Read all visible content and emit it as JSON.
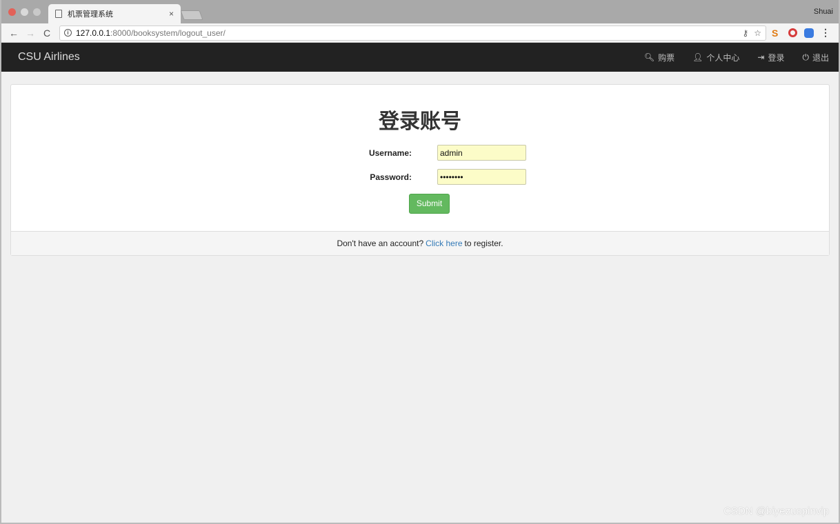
{
  "browser": {
    "tab_title": "机票管理系统",
    "tab_close": "×",
    "profile_name": "Shuai",
    "url_host": "127.0.0.1",
    "url_rest": ":8000/booksystem/logout_user/"
  },
  "navbar": {
    "brand": "CSU Airlines",
    "links": [
      {
        "icon": "search-icon",
        "label": "购票"
      },
      {
        "icon": "user-icon",
        "label": "个人中心"
      },
      {
        "icon": "login-icon",
        "label": "登录"
      },
      {
        "icon": "power-icon",
        "label": "退出"
      }
    ]
  },
  "login": {
    "heading": "登录账号",
    "username_label": "Username:",
    "username_value": "admin",
    "password_label": "Password:",
    "password_value": "••••••••",
    "submit_label": "Submit"
  },
  "footer": {
    "prefix": "Don't have an account?",
    "link": "Click here",
    "suffix": "to register."
  },
  "watermark": "CSDN @biyezuopinvip",
  "colors": {
    "navbar_bg": "#222222",
    "submit_bg": "#63b95f",
    "link": "#337ab7",
    "input_autofill": "#fcfcc8"
  }
}
